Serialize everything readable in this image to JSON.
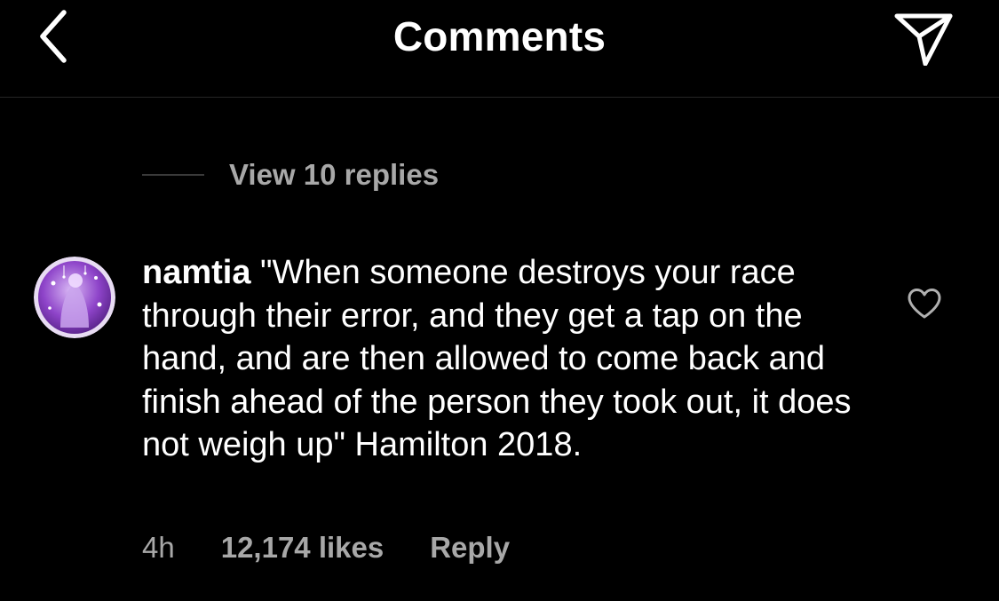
{
  "header": {
    "title": "Comments",
    "back_icon": "chevron-left-icon",
    "share_icon": "paper-plane-icon"
  },
  "replies": {
    "label": "View 10 replies"
  },
  "comment": {
    "avatar_icon": "user-avatar",
    "username": "namtia",
    "text": "\"When someone destroys your race through their error, and they get a tap on the hand, and are then allowed to come back and finish ahead of the person they took out, it does not weigh up\" Hamilton 2018.",
    "time": "4h",
    "likes": "12,174 likes",
    "reply_label": "Reply",
    "like_icon": "heart-outline-icon"
  },
  "colors": {
    "background": "#000000",
    "text": "#ffffff",
    "secondary_text": "#a8a8a8",
    "avatar_accent": "#9b59d0"
  }
}
